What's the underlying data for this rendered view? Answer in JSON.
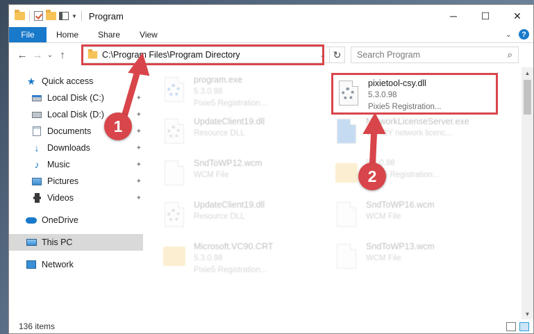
{
  "window": {
    "title": "Program",
    "controls": {
      "minimize": "─",
      "maximize": "☐",
      "close": "✕"
    }
  },
  "ribbon": {
    "tabs": [
      "File",
      "Home",
      "Share",
      "View"
    ],
    "expand": "⌄",
    "help": "?"
  },
  "nav": {
    "back": "←",
    "forward": "→",
    "recent": "⌄",
    "up": "↑",
    "address": "C:\\Program Files\\Program Directory",
    "address_dropdown": "⌄",
    "refresh": "↻",
    "search_placeholder": "Search Program",
    "search_icon": "⌕"
  },
  "sidebar": {
    "items": [
      {
        "label": "Quick access",
        "icon": "star-icon",
        "pinned": false
      },
      {
        "label": "Local Disk (C:)",
        "icon": "disk-icon",
        "pinned": true
      },
      {
        "label": "Local Disk (D:)",
        "icon": "disk-icon",
        "pinned": true
      },
      {
        "label": "Documents",
        "icon": "documents-icon",
        "pinned": true
      },
      {
        "label": "Downloads",
        "icon": "downloads-icon",
        "pinned": true
      },
      {
        "label": "Music",
        "icon": "music-icon",
        "pinned": true
      },
      {
        "label": "Pictures",
        "icon": "pictures-icon",
        "pinned": true
      },
      {
        "label": "Videos",
        "icon": "videos-icon",
        "pinned": true
      },
      {
        "label": "OneDrive",
        "icon": "onedrive-icon",
        "pinned": false
      },
      {
        "label": "This PC",
        "icon": "this-pc-icon",
        "pinned": false,
        "selected": true
      },
      {
        "label": "Network",
        "icon": "network-icon",
        "pinned": false
      }
    ],
    "pin_glyph": "📌"
  },
  "files": {
    "left": [
      {
        "name": "program.exe",
        "line2": "5.3.0.98",
        "line3": "Pixie5 Registration..."
      },
      {
        "name": "UpdateClient19.dll",
        "line2": "Resource DLL",
        "line3": ""
      },
      {
        "name": "SndToWP12.wcm",
        "line2": "WCM File",
        "line3": ""
      },
      {
        "name": "UpdateClient19.dll",
        "line2": "Resource DLL",
        "line3": ""
      },
      {
        "name": "Microsoft.VC90.CRT",
        "line2": "5.3.0.98",
        "line3": "Pixie5 Registration..."
      }
    ],
    "right": [
      {
        "name": "pixietool-csy.dll",
        "line2": "5.3.0.98",
        "line3": "Pixie5 Registration..."
      },
      {
        "name": "NetworkLicenseServer.exe",
        "line2": "TURBY network licenc...",
        "line3": ""
      },
      {
        "name": "",
        "line2": "5.3.0.98",
        "line3": "Pixie5 Registration..."
      },
      {
        "name": "SndToWP16.wcm",
        "line2": "WCM File",
        "line3": ""
      },
      {
        "name": "SndToWP13.wcm",
        "line2": "WCM File",
        "line3": ""
      }
    ]
  },
  "status": {
    "count": "136 items"
  },
  "callouts": [
    "1",
    "2"
  ],
  "colors": {
    "accent": "#1979ca",
    "highlight": "#d8454a"
  }
}
